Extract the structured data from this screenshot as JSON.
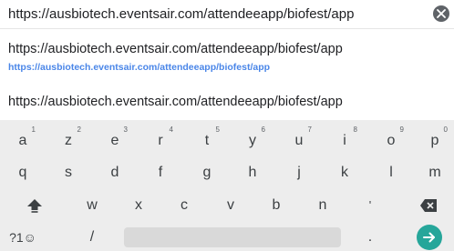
{
  "url_bar": {
    "value": "https://ausbiotech.eventsair.com/attendeeapp/biofest/app",
    "clear_icon": "close-circle-icon"
  },
  "suggestions": [
    {
      "title": "https://ausbiotech.eventsair.com/attendeeapp/biofest/app",
      "url": "https://ausbiotech.eventsair.com/attendeeapp/biofest/app"
    },
    {
      "title": "https://ausbiotech.eventsair.com/attendeeapp/biofest/app"
    }
  ],
  "keyboard": {
    "row1": [
      {
        "key": "a",
        "hint": "1"
      },
      {
        "key": "z",
        "hint": "2"
      },
      {
        "key": "e",
        "hint": "3"
      },
      {
        "key": "r",
        "hint": "4"
      },
      {
        "key": "t",
        "hint": "5"
      },
      {
        "key": "y",
        "hint": "6"
      },
      {
        "key": "u",
        "hint": "7"
      },
      {
        "key": "i",
        "hint": "8"
      },
      {
        "key": "o",
        "hint": "9"
      },
      {
        "key": "p",
        "hint": "0"
      }
    ],
    "row2": [
      "q",
      "s",
      "d",
      "f",
      "g",
      "h",
      "j",
      "k",
      "l",
      "m"
    ],
    "row3": [
      "w",
      "x",
      "c",
      "v",
      "b",
      "n",
      "'"
    ],
    "row4": {
      "symbols": "?1☺",
      "slash": "/",
      "period": "."
    },
    "icons": {
      "shift": "shift-arrow-icon",
      "backspace": "backspace-icon",
      "enter": "arrow-right-icon"
    },
    "colors": {
      "enter_bg": "#26a69a",
      "suggestion_url": "#4a86e8"
    }
  }
}
